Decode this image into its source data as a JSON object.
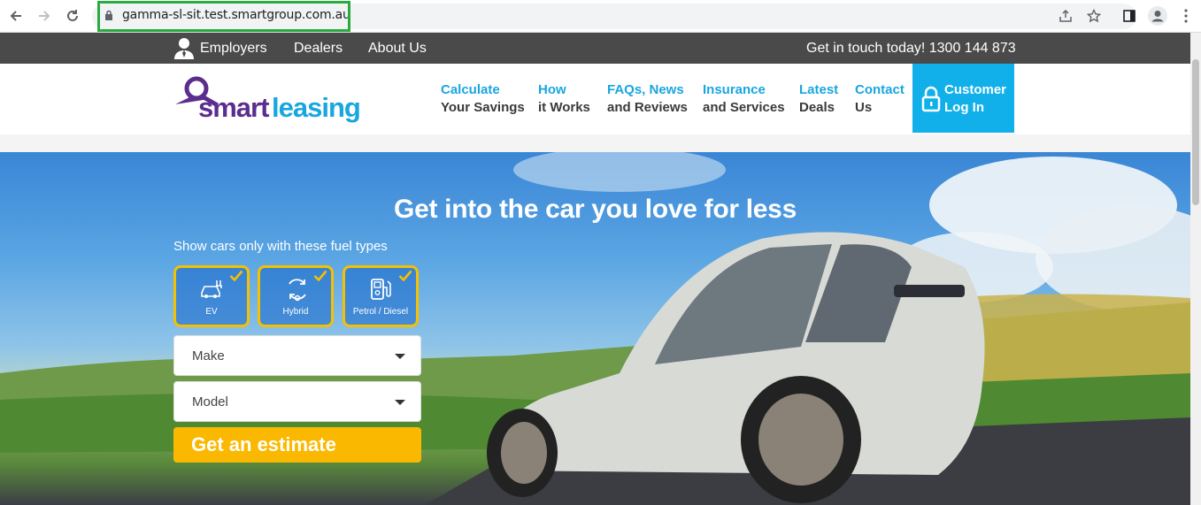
{
  "browser": {
    "url": "gamma-sl-sit.test.smartgroup.com.au"
  },
  "topbar": {
    "links": [
      "Employers",
      "Dealers",
      "About Us"
    ],
    "contact": "Get in touch today! 1300 144 873"
  },
  "logo": {
    "text_smart": "smart",
    "text_leasing": "leasing"
  },
  "nav": [
    {
      "line1": "Calculate",
      "line2": "Your Savings"
    },
    {
      "line1": "How",
      "line2": "it Works"
    },
    {
      "line1": "FAQs, News",
      "line2": "and Reviews"
    },
    {
      "line1": "Insurance",
      "line2": "and Services"
    },
    {
      "line1": "Latest",
      "line2": "Deals"
    },
    {
      "line1": "Contact",
      "line2": "Us"
    }
  ],
  "login": {
    "line1": "Customer",
    "line2": "Log In"
  },
  "hero": {
    "title": "Get into the car you love for less",
    "fuel_label": "Show cars only with these fuel types",
    "fuel_types": [
      "EV",
      "Hybrid",
      "Petrol / Diesel"
    ],
    "make_placeholder": "Make",
    "model_placeholder": "Model",
    "cta": "Get an estimate"
  },
  "colors": {
    "accent_blue": "#19a6df",
    "login_blue": "#11b0ea",
    "cta_yellow": "#fbb800",
    "logo_purple": "#5b2d8e",
    "topbar_grey": "#4a4a4a",
    "url_highlight": "#2bab3f"
  }
}
